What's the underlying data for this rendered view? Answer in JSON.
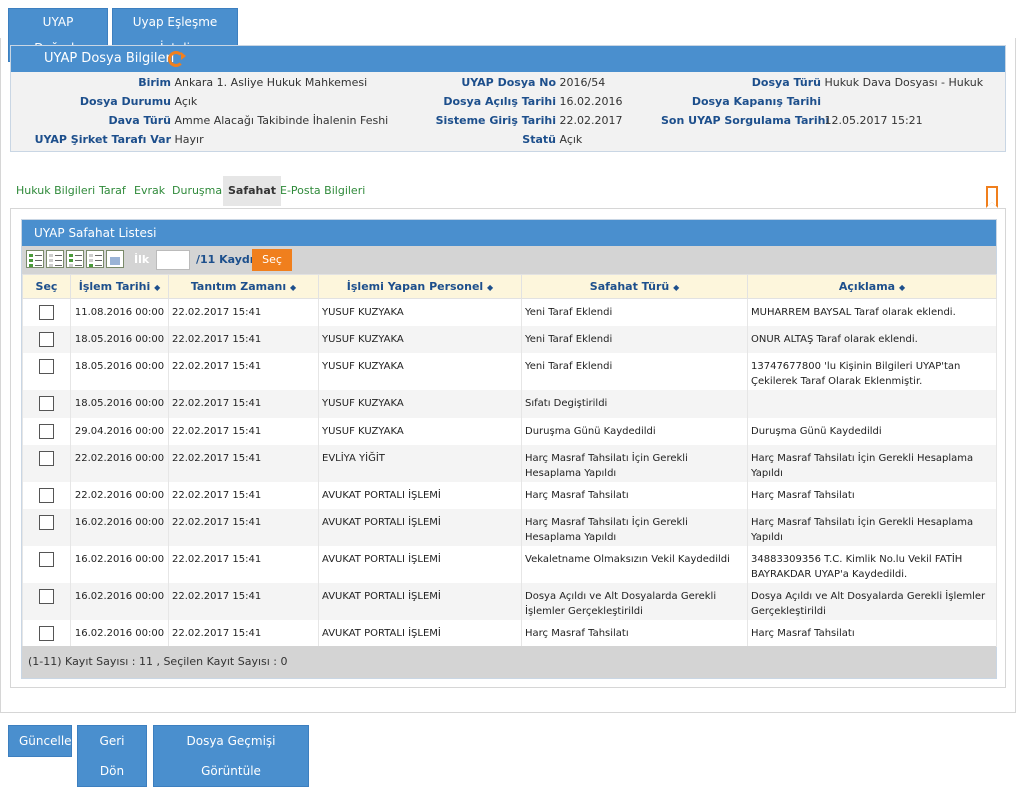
{
  "top_buttons": {
    "dogrula": "UYAP Doğrula",
    "esleme_iptal": "Uyap Eşleşme İptali"
  },
  "info": {
    "title": "UYAP Dosya Bilgileri",
    "birim_lbl": "Birim",
    "birim": "Ankara 1. Asliye Hukuk Mahkemesi",
    "dosya_no_lbl": "UYAP Dosya No",
    "dosya_no": "2016/54",
    "dosya_turu_lbl": "Dosya Türü",
    "dosya_turu": "Hukuk Dava Dosyası - Hukuk",
    "dosya_durumu_lbl": "Dosya Durumu",
    "dosya_durumu": "Açık",
    "acilis_lbl": "Dosya Açılış Tarihi",
    "acilis": "16.02.2016",
    "kapanis_lbl": "Dosya Kapanış Tarihi",
    "kapanis": "",
    "dava_turu_lbl": "Dava Türü",
    "dava_turu": "Amme Alacağı Takibinde İhalenin Feshi",
    "sisteme_giris_lbl": "Sisteme Giriş Tarihi",
    "sisteme_giris": "22.02.2017",
    "son_sorgu_lbl": "Son UYAP Sorgulama Tarihi",
    "son_sorgu": "12.05.2017 15:21",
    "sirket_lbl": "UYAP Şirket Tarafı Var",
    "sirket": "Hayır",
    "statu_lbl": "Statü",
    "statu": "Açık"
  },
  "tabs": [
    "Hukuk Bilgileri",
    "Taraf",
    "Evrak",
    "Duruşma",
    "Safahat",
    "E-Posta Bilgileri"
  ],
  "list": {
    "title": "UYAP Safahat Listesi",
    "ilk_label": "İlk",
    "page_input": "",
    "kayit_label": "/11 Kaydı",
    "sec_button": "Seç",
    "columns": [
      "Seç",
      "İşlem Tarihi",
      "Tanıtım Zamanı",
      "İşlemi Yapan Personel",
      "Safahat Türü",
      "Açıklama"
    ],
    "sort_glyph": "◆",
    "rows": [
      [
        "11.08.2016 00:00",
        "22.02.2017 15:41",
        "YUSUF KUZYAKA",
        "Yeni Taraf Eklendi",
        "MUHARREM BAYSAL Taraf olarak eklendi."
      ],
      [
        "18.05.2016 00:00",
        "22.02.2017 15:41",
        "YUSUF KUZYAKA",
        "Yeni Taraf Eklendi",
        "ONUR ALTAŞ Taraf olarak eklendi."
      ],
      [
        "18.05.2016 00:00",
        "22.02.2017 15:41",
        "YUSUF KUZYAKA",
        "Yeni Taraf Eklendi",
        "13747677800 'lu Kişinin Bilgileri UYAP'tan Çekilerek Taraf Olarak Eklenmiştir."
      ],
      [
        "18.05.2016 00:00",
        "22.02.2017 15:41",
        "YUSUF KUZYAKA",
        "Sıfatı Degiştirildi",
        ""
      ],
      [
        "29.04.2016 00:00",
        "22.02.2017 15:41",
        "YUSUF KUZYAKA",
        "Duruşma Günü Kaydedildi",
        "Duruşma Günü Kaydedildi"
      ],
      [
        "22.02.2016 00:00",
        "22.02.2017 15:41",
        "EVLİYA YİĞİT",
        "Harç Masraf Tahsilatı İçin Gerekli Hesaplama Yapıldı",
        "Harç Masraf Tahsilatı İçin Gerekli Hesaplama Yapıldı"
      ],
      [
        "22.02.2016 00:00",
        "22.02.2017 15:41",
        "AVUKAT PORTALI İŞLEMİ",
        "Harç Masraf Tahsilatı",
        "Harç Masraf Tahsilatı"
      ],
      [
        "16.02.2016 00:00",
        "22.02.2017 15:41",
        "AVUKAT PORTALI İŞLEMİ",
        "Harç Masraf Tahsilatı İçin Gerekli Hesaplama Yapıldı",
        "Harç Masraf Tahsilatı İçin Gerekli Hesaplama Yapıldı"
      ],
      [
        "16.02.2016 00:00",
        "22.02.2017 15:41",
        "AVUKAT PORTALI İŞLEMİ",
        "Vekaletname Olmaksızın Vekil Kaydedildi",
        "34883309356 T.C. Kimlik No.lu Vekil FATİH BAYRAKDAR UYAP'a Kaydedildi."
      ],
      [
        "16.02.2016 00:00",
        "22.02.2017 15:41",
        "AVUKAT PORTALI İŞLEMİ",
        "Dosya Açıldı ve Alt Dosyalarda Gerekli İşlemler Gerçekleştirildi",
        "Dosya Açıldı ve Alt Dosyalarda Gerekli İşlemler Gerçekleştirildi"
      ],
      [
        "16.02.2016 00:00",
        "22.02.2017 15:41",
        "AVUKAT PORTALI İŞLEMİ",
        "Harç Masraf Tahsilatı",
        "Harç Masraf Tahsilatı"
      ]
    ],
    "footer": "(1-11) Kayıt Sayısı : 11  , Seçilen Kayıt Sayısı : 0"
  },
  "bottom_buttons": {
    "guncelle": "Güncelle",
    "geri_don": "Geri Dön",
    "gecmis": "Dosya Geçmişi Görüntüle"
  },
  "icons": {
    "refresh": "refresh-icon",
    "bookmark": "bookmark-icon",
    "toolbar": [
      "select-all-icon",
      "deselect-all-icon",
      "select-page-icon",
      "deselect-page-icon",
      "export-icon"
    ]
  },
  "colors": {
    "header_blue": "#4a8fce",
    "accent_orange": "#f07f1d",
    "label_blue": "#1d4f8c",
    "tab_green": "#2f8a3a"
  }
}
